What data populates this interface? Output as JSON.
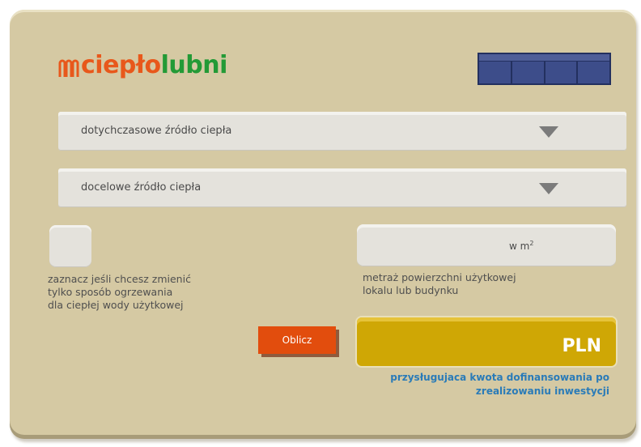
{
  "logo": {
    "part1": "ciepło",
    "part2": "lubni"
  },
  "heat_source_current": {
    "label": "dotychczasowe źródło ciepła"
  },
  "heat_source_target": {
    "label": "docelowe źródło ciepła"
  },
  "hot_water_checkbox": {
    "line1": "zaznacz jeśli chcesz zmienić",
    "line2": "tylko sposób ogrzewania",
    "line3": "dla ciepłej wody użytkowej"
  },
  "area": {
    "unit": "w m",
    "unit_sup": "2",
    "note_line1": "metraż powierzchni użytkowej",
    "note_line2": "lokalu lub budynku"
  },
  "calculate_button": {
    "label": "Oblicz"
  },
  "result": {
    "currency": "PLN",
    "hint_line1": "przysługujaca kwota dofinansowania po",
    "hint_line2": "zrealizowaniu inwestycji"
  },
  "colors": {
    "panel": "#d5c9a3",
    "brand_orange": "#e8581b",
    "brand_green": "#239a36",
    "button": "#e24d0d",
    "result": "#cfa705",
    "hint": "#2a7bb8"
  }
}
